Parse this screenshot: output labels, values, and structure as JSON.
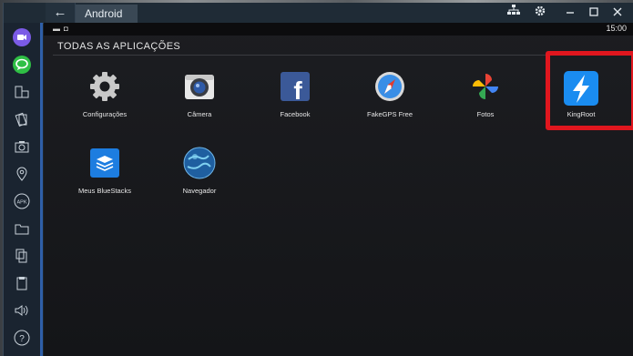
{
  "window": {
    "back_label": "←",
    "tab_label": "Android"
  },
  "titlebar_icons": [
    "network-icon",
    "gear-icon",
    "minimize-icon",
    "maximize-icon",
    "close-icon"
  ],
  "statusbar": {
    "time": "15:00"
  },
  "section": {
    "title": "TODAS AS APLICAÇÕES"
  },
  "apps": [
    {
      "label": "Configurações",
      "icon": "settings-gear-icon"
    },
    {
      "label": "Câmera",
      "icon": "camera-icon"
    },
    {
      "label": "Facebook",
      "icon": "facebook-icon"
    },
    {
      "label": "FakeGPS Free",
      "icon": "compass-icon"
    },
    {
      "label": "Fotos",
      "icon": "photos-pinwheel-icon"
    },
    {
      "label": "KingRoot",
      "icon": "lightning-icon"
    },
    {
      "label": "Meus BlueStacks",
      "icon": "bluestacks-icon"
    },
    {
      "label": "Navegador",
      "icon": "globe-icon"
    }
  ],
  "sidebar_items": [
    "video-call-icon",
    "chat-icon",
    "layout-icon",
    "rotate-icon",
    "camera-icon",
    "location-icon",
    "apk-icon",
    "folder-icon",
    "copy-icon",
    "paste-icon",
    "volume-icon",
    "help-icon"
  ],
  "highlight_color": "#e0161e",
  "accent_color": "#2f5fa8"
}
